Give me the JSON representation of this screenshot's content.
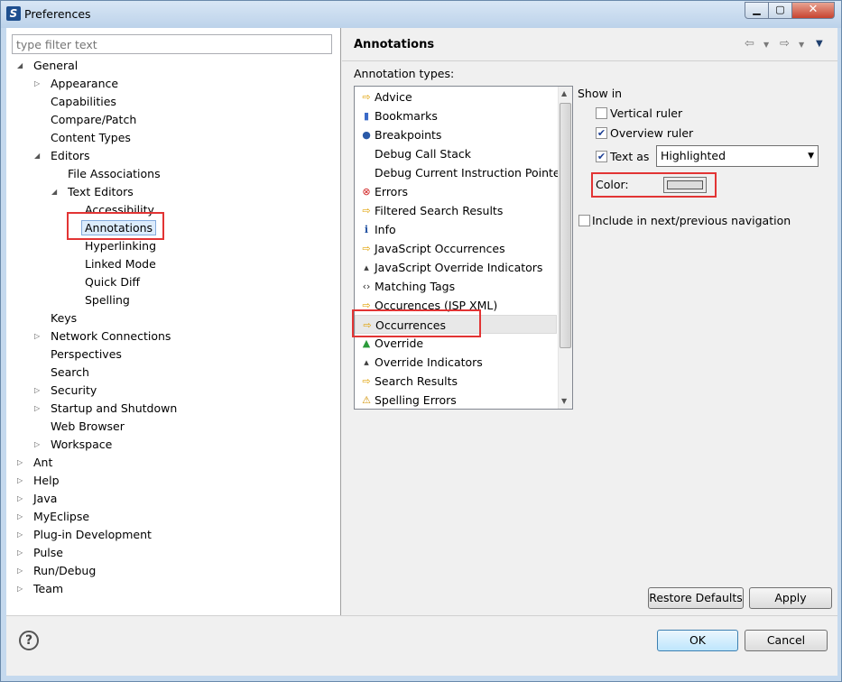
{
  "window": {
    "title": "Preferences",
    "controls": {
      "minimize": "▁",
      "maximize": "▢",
      "close": "✕"
    }
  },
  "filter": {
    "placeholder": "type filter text",
    "value": ""
  },
  "tree": [
    {
      "label": "General",
      "expanded": true
    },
    {
      "label": "Appearance"
    },
    {
      "label": "Capabilities"
    },
    {
      "label": "Compare/Patch"
    },
    {
      "label": "Content Types"
    },
    {
      "label": "Editors",
      "expanded": true
    },
    {
      "label": "File Associations"
    },
    {
      "label": "Text Editors",
      "expanded": true
    },
    {
      "label": "Accessibility"
    },
    {
      "label": "Annotations",
      "selected": true
    },
    {
      "label": "Hyperlinking"
    },
    {
      "label": "Linked Mode"
    },
    {
      "label": "Quick Diff"
    },
    {
      "label": "Spelling"
    },
    {
      "label": "Keys"
    },
    {
      "label": "Network Connections"
    },
    {
      "label": "Perspectives"
    },
    {
      "label": "Search"
    },
    {
      "label": "Security"
    },
    {
      "label": "Startup and Shutdown"
    },
    {
      "label": "Web Browser"
    },
    {
      "label": "Workspace"
    },
    {
      "label": "Ant"
    },
    {
      "label": "Help"
    },
    {
      "label": "Java"
    },
    {
      "label": "MyEclipse"
    },
    {
      "label": "Plug-in Development"
    },
    {
      "label": "Pulse"
    },
    {
      "label": "Run/Debug"
    },
    {
      "label": "Team"
    }
  ],
  "page": {
    "title": "Annotations",
    "annotation_types_label": "Annotation types:",
    "annotation_types": [
      {
        "label": "Advice",
        "icon": "arrow-icon"
      },
      {
        "label": "Bookmarks",
        "icon": "bookmark-icon"
      },
      {
        "label": "Breakpoints",
        "icon": "breakpoint-icon"
      },
      {
        "label": "Debug Call Stack",
        "icon": ""
      },
      {
        "label": "Debug Current Instruction Pointer",
        "icon": ""
      },
      {
        "label": "Errors",
        "icon": "error-icon"
      },
      {
        "label": "Filtered Search Results",
        "icon": "arrow-icon"
      },
      {
        "label": "Info",
        "icon": "info-icon"
      },
      {
        "label": "JavaScript Occurrences",
        "icon": "arrow-icon"
      },
      {
        "label": "JavaScript Override Indicators",
        "icon": "override-indicator-icon"
      },
      {
        "label": "Matching Tags",
        "icon": "tag-icon"
      },
      {
        "label": "Occurences (JSP XML)",
        "icon": "arrow-icon"
      },
      {
        "label": "Occurrences",
        "icon": "arrow-icon",
        "selected": true
      },
      {
        "label": "Override",
        "icon": "override-icon"
      },
      {
        "label": "Override Indicators",
        "icon": "override-indicator-icon"
      },
      {
        "label": "Search Results",
        "icon": "arrow-icon"
      },
      {
        "label": "Spelling Errors",
        "icon": "warning-icon"
      }
    ],
    "show_in_label": "Show in",
    "vertical_ruler": {
      "label": "Vertical ruler",
      "checked": false
    },
    "overview_ruler": {
      "label": "Overview ruler",
      "checked": true
    },
    "text_as": {
      "label": "Text as",
      "checked": true,
      "selected": "Highlighted"
    },
    "color_label": "Color:",
    "color_value": "#dcdcdc",
    "include_nav": {
      "label": "Include in next/previous navigation",
      "checked": false
    },
    "restore_defaults": "Restore Defaults",
    "apply": "Apply"
  },
  "footer": {
    "ok": "OK",
    "cancel": "Cancel",
    "help": "?"
  },
  "glyphs": {
    "expanded": "◢",
    "collapsed": "▷",
    "check": "✔",
    "dropdown": "▼",
    "scroll_up": "▲",
    "scroll_down": "▼",
    "back": "⇦",
    "forward": "⇨",
    "menu": "▼"
  },
  "colors": {
    "highlight_box": "#e23434",
    "selection_bg": "#dcecfc"
  }
}
